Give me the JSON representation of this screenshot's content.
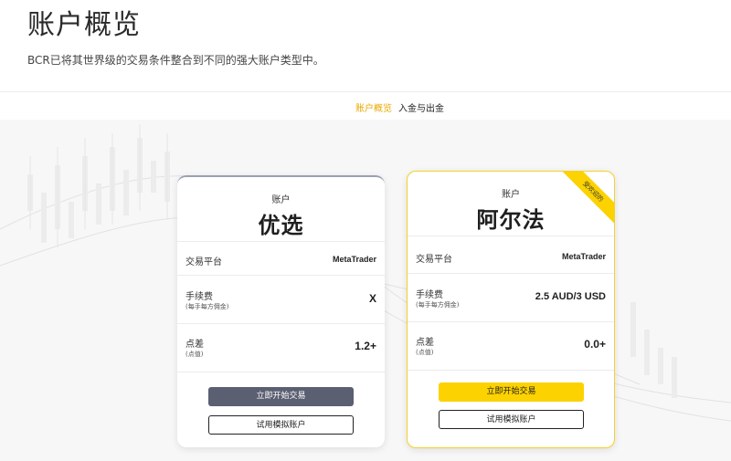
{
  "page": {
    "title": "账户概览",
    "subtitle": "BCR已将其世界级的交易条件整合到不同的强大账户类型中。"
  },
  "tabs": [
    {
      "label": "账户概览",
      "active": true
    },
    {
      "label": "入金与出金",
      "active": false
    }
  ],
  "colors": {
    "accent": "#fcd200",
    "dark_button": "#5b5f72",
    "active_tab": "#e8a800"
  },
  "cards": [
    {
      "kicker": "账户",
      "name": "优选",
      "platform_label": "交易平台",
      "platform_value": "MetaTrader",
      "commission_label": "手续费",
      "commission_sub": "(每手每方佣金)",
      "commission_value": "X",
      "spread_label": "点差",
      "spread_sub": "(点值)",
      "spread_value": "1.2+",
      "primary_button": "立即开始交易",
      "secondary_button": "试用模拟账户"
    },
    {
      "kicker": "账户",
      "name": "阿尔法",
      "ribbon": "受欢迎的",
      "platform_label": "交易平台",
      "platform_value": "MetaTrader",
      "commission_label": "手续费",
      "commission_sub": "(每手每方佣金)",
      "commission_value": "2.5 AUD/3 USD",
      "spread_label": "点差",
      "spread_sub": "(点值)",
      "spread_value": "0.0+",
      "primary_button": "立即开始交易",
      "secondary_button": "试用模拟账户"
    }
  ]
}
